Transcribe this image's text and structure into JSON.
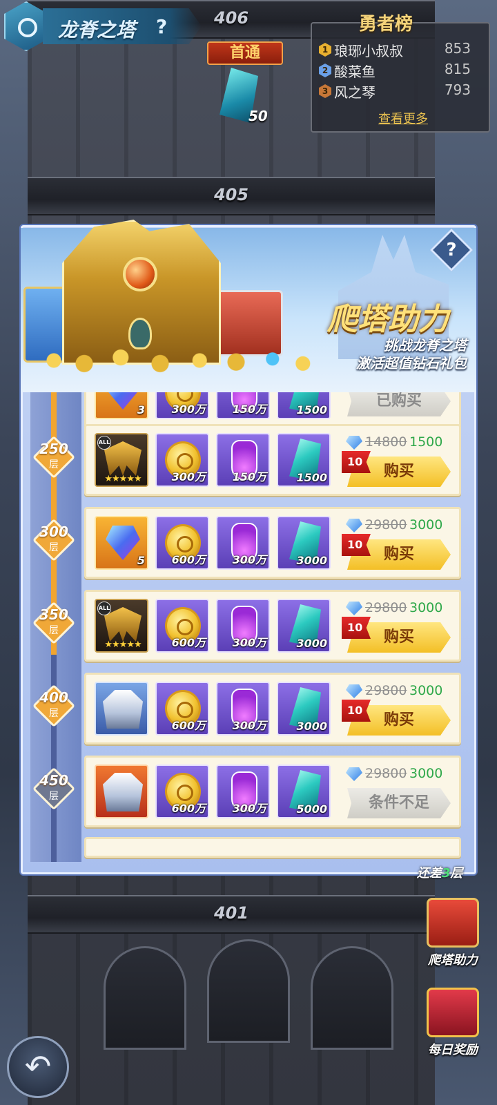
{
  "header": {
    "title": "龙脊之塔",
    "help": "?"
  },
  "floors": {
    "top": "406",
    "second": "405",
    "bottom": "401"
  },
  "first_clear": {
    "label": "首通",
    "count": "50"
  },
  "leaderboard": {
    "title": "勇者榜",
    "rows": [
      {
        "rank": "1",
        "name": "琅琊小叔叔",
        "score": "853",
        "color": "#e8b030"
      },
      {
        "rank": "2",
        "name": "酸菜鱼",
        "score": "815",
        "color": "#6aa0e8"
      },
      {
        "rank": "3",
        "name": "风之琴",
        "score": "793",
        "color": "#c87838"
      }
    ],
    "more": "查看更多"
  },
  "modal": {
    "banner_title": "爬塔助力",
    "banner_sub1": "挑战龙脊之塔",
    "banner_sub2": "激活超值钻石礼包",
    "help": "?"
  },
  "tiers": [
    {
      "floor": "250",
      "unit": "层"
    },
    {
      "floor": "300",
      "unit": "层"
    },
    {
      "floor": "350",
      "unit": "层"
    },
    {
      "floor": "400",
      "unit": "层"
    },
    {
      "floor": "450",
      "unit": "层"
    }
  ],
  "partial_row": {
    "item1_qty": "3",
    "item2_qty": "300万",
    "item3_qty": "150万",
    "item4_qty": "1500",
    "button": "已购买"
  },
  "rows": [
    {
      "item1_all": "ALL",
      "item1_qty": "",
      "item2_qty": "300万",
      "item3_qty": "150万",
      "item4_qty": "1500",
      "old_price": "14800",
      "new_price": "1500",
      "limit": "10",
      "button": "购买"
    },
    {
      "item1_all": "",
      "item1_qty": "5",
      "item2_qty": "600万",
      "item3_qty": "300万",
      "item4_qty": "3000",
      "old_price": "29800",
      "new_price": "3000",
      "limit": "10",
      "button": "购买"
    },
    {
      "item1_all": "ALL",
      "item1_qty": "",
      "item2_qty": "600万",
      "item3_qty": "300万",
      "item4_qty": "3000",
      "old_price": "29800",
      "new_price": "3000",
      "limit": "10",
      "button": "购买"
    },
    {
      "item1_all": "",
      "item1_qty": "",
      "item2_qty": "600万",
      "item3_qty": "300万",
      "item4_qty": "3000",
      "old_price": "29800",
      "new_price": "3000",
      "limit": "10",
      "button": "购买"
    },
    {
      "item1_all": "",
      "item1_qty": "",
      "item2_qty": "600万",
      "item3_qty": "300万",
      "item4_qty": "5000",
      "old_price": "29800",
      "new_price": "3000",
      "limit": "",
      "button": "条件不足"
    }
  ],
  "side": {
    "remaining_prefix": "还差",
    "remaining_num": "3",
    "remaining_suffix": "层",
    "climb_help": "爬塔助力",
    "daily_reward": "每日奖励"
  },
  "back": "↶"
}
